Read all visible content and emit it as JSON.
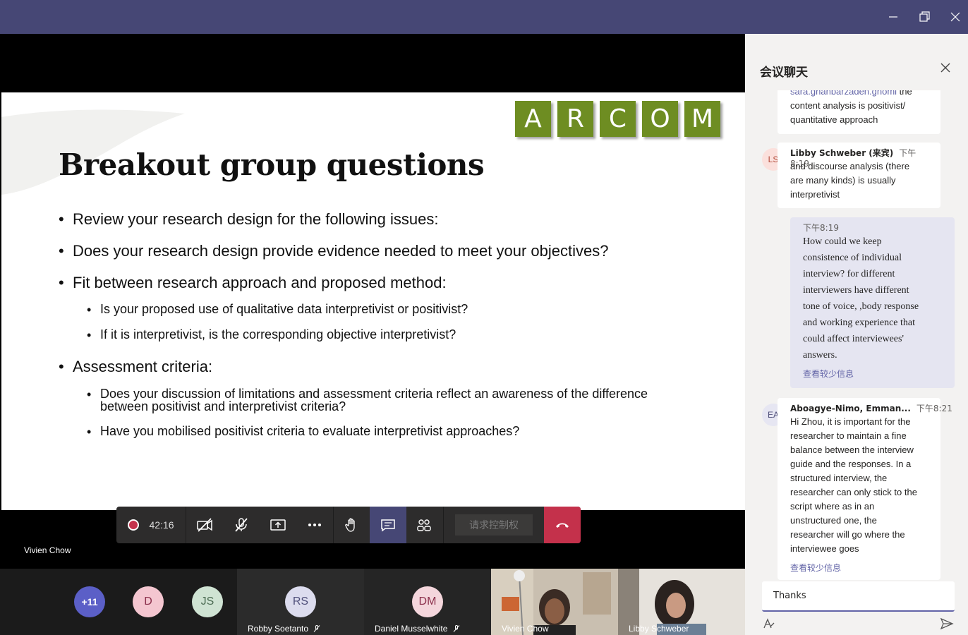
{
  "window": {
    "minimize_icon": "minimize-icon",
    "maximize_icon": "restore-icon",
    "close_icon": "close-icon"
  },
  "slide": {
    "logo_letters": [
      "A",
      "R",
      "C",
      "O",
      "M"
    ],
    "title": "Breakout group questions",
    "bullets": [
      "Review your research design for the following issues:",
      "Does your research design provide evidence needed to meet your objectives?",
      "Fit between research approach and proposed method:",
      "Is your proposed use of qualitative data interpretivist or positivist?",
      "If it is interpretivist, is the corresponding objective interpretivist?",
      "Assessment criteria:",
      "Does your discussion of limitations and assessment criteria reflect an awareness of the difference between positivist and interpretivist criteria?",
      "Have you mobilised positivist criteria to evaluate interpretivist approaches?"
    ]
  },
  "toolbar": {
    "timer": "42:16",
    "request_control": "请求控制权",
    "recording_color": "#c4314b",
    "hangup_color": "#c4314b"
  },
  "presenter_name": "Vivien Chow",
  "participants": {
    "overflow": "+11",
    "avatars": [
      {
        "initials": "D",
        "color": "#f4c6d0",
        "text_color": "#8b2f4b"
      },
      {
        "initials": "JS",
        "color": "#cfe3d3",
        "text_color": "#4b6b52"
      }
    ],
    "tiles": [
      {
        "initials": "RS",
        "name": "Robby Soetanto",
        "color": "#dcdcee",
        "text_color": "#4f4f7a"
      },
      {
        "initials": "DM",
        "name": "Daniel Musselwhite",
        "color": "#f4d6dc",
        "text_color": "#8b2f4b"
      },
      {
        "name": "Vivien Chow"
      },
      {
        "name": "Libby Schweber"
      }
    ]
  },
  "chat": {
    "title": "会议聊天",
    "messages": [
      {
        "mention": "sara.ghanbarzaden.gnomi",
        "text_lines": [
          " the",
          "content analysis is positivist/",
          "quantitative approach"
        ]
      },
      {
        "initials": "LS",
        "sender": "Libby Schweber (来宾)",
        "time": "下午8:19",
        "text_lines": [
          "and discourse analysis (there",
          "are many kinds) is usually",
          "interpretivist"
        ]
      },
      {
        "time": "下午8:19",
        "text_lines": [
          "How could we keep",
          "consistence of individual",
          "interview? for different",
          "interviewers have different",
          "tone of voice, ,body response",
          "and working experience that",
          "could affect interviewees'",
          "answers."
        ],
        "see_less": "查看较少信息"
      },
      {
        "initials": "EA",
        "sender": "Aboagye-Nimo, Emman...",
        "time": "下午8:21",
        "text_lines": [
          "Hi Zhou, it is important for the",
          "researcher to maintain a fine",
          "balance between the interview",
          "guide and the responses. In a",
          "structured interview, the",
          "researcher can only stick to the",
          "script where as in an",
          "unstructured one, the",
          "researcher will go where the",
          "interviewee goes"
        ],
        "see_less": "查看较少信息"
      }
    ],
    "compose_value": "Thanks",
    "accent_color": "#6264a7"
  }
}
